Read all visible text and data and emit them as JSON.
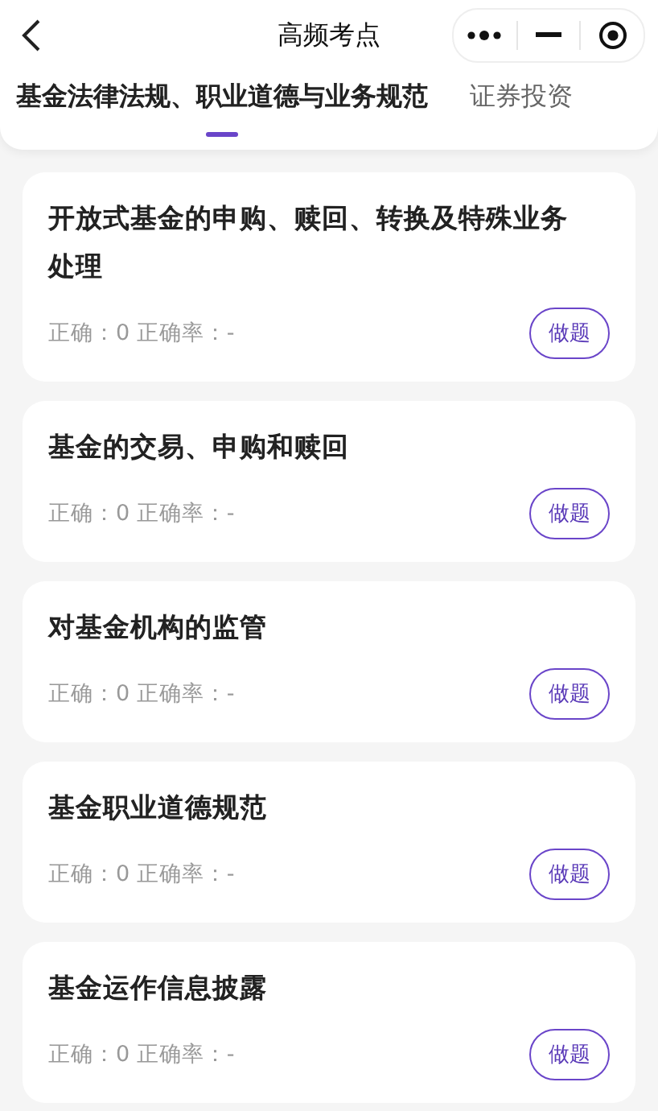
{
  "header": {
    "title": "高频考点"
  },
  "tabs": [
    {
      "label": "基金法律法规、职业道德与业务规范",
      "selected": true
    },
    {
      "label": "证券投资",
      "selected": false
    }
  ],
  "cards": [
    {
      "title": "开放式基金的申购、赎回、转换及特殊业务处理",
      "stats": "正确：0 正确率：-",
      "button": "做题"
    },
    {
      "title": "基金的交易、申购和赎回",
      "stats": "正确：0 正确率：-",
      "button": "做题"
    },
    {
      "title": "对基金机构的监管",
      "stats": "正确：0 正确率：-",
      "button": "做题"
    },
    {
      "title": "基金职业道德规范",
      "stats": "正确：0 正确率：-",
      "button": "做题"
    },
    {
      "title": "基金运作信息披露",
      "stats": "正确：0 正确率：-",
      "button": "做题"
    }
  ]
}
